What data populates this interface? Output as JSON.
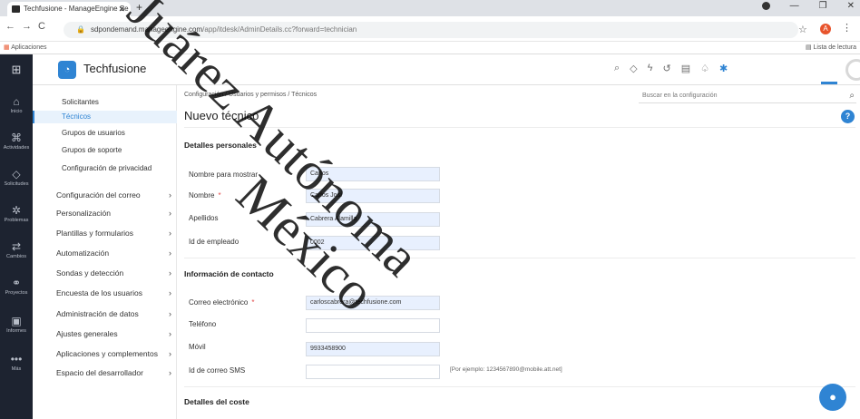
{
  "browser": {
    "tab_title": "Techfusione - ManageEngine Se",
    "url_host": "sdpondemand.manageengine.com",
    "url_path": "/app/itdesk/AdminDetails.cc?forward=technician",
    "bookmarks_apps": "Aplicaciones",
    "reading_list": "Lista de lectura"
  },
  "app": {
    "brand": "Techfusione"
  },
  "leftnav": [
    {
      "label": "Inicio",
      "icon": "home-icon"
    },
    {
      "label": "Actividades",
      "icon": "activities-icon"
    },
    {
      "label": "Solicitudes",
      "icon": "requests-icon"
    },
    {
      "label": "Problemas",
      "icon": "problems-icon"
    },
    {
      "label": "Cambios",
      "icon": "changes-icon"
    },
    {
      "label": "Proyectos",
      "icon": "projects-icon"
    },
    {
      "label": "Informes",
      "icon": "reports-icon"
    },
    {
      "label": "Más",
      "icon": "more-icon"
    }
  ],
  "submenu": {
    "sub_items": [
      "Solicitantes",
      "Técnicos",
      "Grupos de usuarios",
      "Grupos de soporte",
      "Configuración de privacidad"
    ],
    "main_items": [
      "Configuración del correo",
      "Personalización",
      "Plantillas y formularios",
      "Automatización",
      "Sondas y detección",
      "Encuesta de los usuarios",
      "Administración de datos",
      "Ajustes generales",
      "Aplicaciones y complementos",
      "Espacio del desarrollador"
    ]
  },
  "main": {
    "breadcrumb": "Configuración / Usuarios y permisos / Técnicos",
    "search_placeholder": "Buscar en la configuración",
    "title": "Nuevo técnico",
    "help": "?",
    "personal_section": "Detalles personales",
    "display_name_label": "Nombre para mostrar",
    "display_name_value": "Carlos",
    "first_name_label": "Nombre",
    "first_name_value": "Carlos Josí",
    "last_name_label": "Apellidos",
    "last_name_value": "Cabrera Alamilla",
    "employee_id_label": "Id de empleado",
    "employee_id_value": "0002",
    "contact_section": "Información de contacto",
    "email_label": "Correo electrónico",
    "email_value": "carloscabrera@techfusione.com",
    "phone_label": "Teléfono",
    "phone_value": "",
    "mobile_label": "Móvil",
    "mobile_value": "9933458900",
    "sms_label": "Id de correo SMS",
    "sms_value": "",
    "sms_hint": "[Por ejemplo: 1234567890@mobile.att.net]",
    "cost_section": "Detalles del coste",
    "required_mark": "*"
  },
  "watermark": {
    "line1": "Juárez Autónoma",
    "line2": "México"
  },
  "colors": {
    "accent": "#2f84d3",
    "sidebar": "#1d2330"
  }
}
